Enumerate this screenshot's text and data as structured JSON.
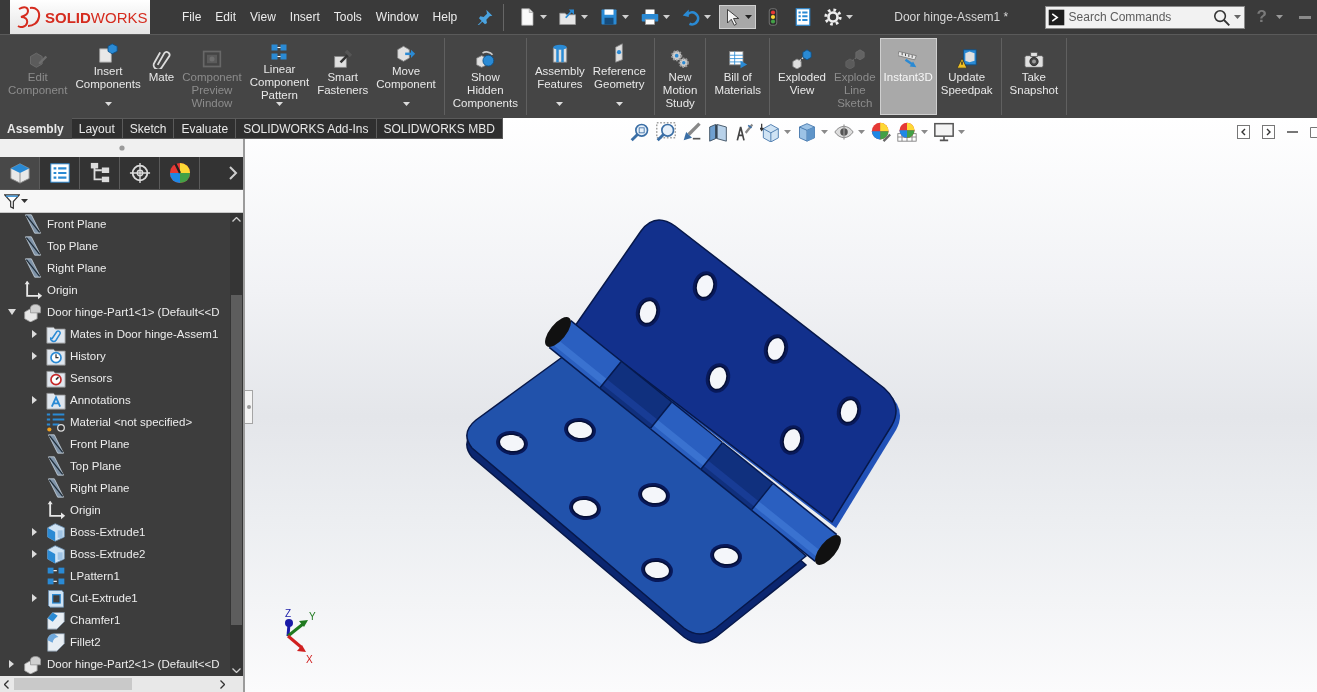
{
  "title_bar": {
    "logo": "**SOLID**WORKS",
    "menu": [
      "File",
      "Edit",
      "View",
      "Insert",
      "Tools",
      "Window",
      "Help"
    ],
    "quick_access": [
      {
        "kind": "document",
        "dropdown": true,
        "selected": false
      },
      {
        "kind": "folder",
        "dropdown": true,
        "selected": false
      },
      {
        "kind": "disk",
        "dropdown": true,
        "selected": false
      },
      {
        "kind": "printer",
        "dropdown": true,
        "selected": false
      },
      {
        "kind": "undo",
        "dropdown": true,
        "selected": false
      },
      {
        "kind": "pointer",
        "dropdown": true,
        "selected": true
      },
      {
        "kind": "trafficlight",
        "dropdown": false,
        "selected": false
      },
      {
        "kind": "list",
        "dropdown": false,
        "selected": false
      },
      {
        "kind": "gear",
        "dropdown": true,
        "selected": false
      }
    ],
    "document_title": "Door hinge-Assem1 *",
    "search": {
      "placeholder": "Search Commands"
    },
    "help": "?"
  },
  "ribbon": {
    "groups": [
      {
        "items": [
          {
            "label": "Edit Component",
            "kind": "editcomponent",
            "disabled": true,
            "selected": false,
            "dropdown": false
          },
          {
            "label": "Insert Components",
            "kind": "insert",
            "disabled": false,
            "selected": false,
            "dropdown": true
          },
          {
            "label": "Mate",
            "kind": "mate",
            "disabled": false,
            "selected": false,
            "dropdown": false
          },
          {
            "label": "Component Preview Window",
            "kind": "preview",
            "disabled": true,
            "selected": false,
            "dropdown": false
          },
          {
            "label": "Linear Component Pattern",
            "kind": "pattern",
            "disabled": false,
            "selected": false,
            "dropdown": true
          },
          {
            "label": "Smart Fasteners",
            "kind": "fasteners",
            "disabled": false,
            "selected": false,
            "dropdown": false
          },
          {
            "label": "Move Component",
            "kind": "move",
            "disabled": false,
            "selected": false,
            "dropdown": true
          }
        ]
      },
      {
        "items": [
          {
            "label": "Show Hidden Components",
            "kind": "show",
            "disabled": false,
            "selected": false,
            "dropdown": false
          }
        ]
      },
      {
        "items": [
          {
            "label": "Assembly Features",
            "kind": "features",
            "disabled": false,
            "selected": false,
            "dropdown": true
          },
          {
            "label": "Reference Geometry",
            "kind": "reference",
            "disabled": false,
            "selected": false,
            "dropdown": true
          }
        ]
      },
      {
        "items": [
          {
            "label": "New Motion Study",
            "kind": "motion",
            "disabled": false,
            "selected": false,
            "dropdown": false
          }
        ]
      },
      {
        "items": [
          {
            "label": "Bill of Materials",
            "kind": "bom",
            "disabled": false,
            "selected": false,
            "dropdown": false
          }
        ]
      },
      {
        "items": [
          {
            "label": "Exploded View",
            "kind": "explode",
            "disabled": false,
            "selected": false,
            "dropdown": false
          },
          {
            "label": "Explode Line Sketch",
            "kind": "explodeline",
            "disabled": true,
            "selected": false,
            "dropdown": false
          },
          {
            "label": "Instant3D",
            "kind": "instant3d",
            "disabled": false,
            "selected": true,
            "dropdown": false
          },
          {
            "label": "Update Speedpak",
            "kind": "speedpak",
            "disabled": false,
            "selected": false,
            "dropdown": false
          }
        ]
      },
      {
        "items": [
          {
            "label": "Take Snapshot",
            "kind": "snapshot",
            "disabled": false,
            "selected": false,
            "dropdown": false
          }
        ]
      }
    ]
  },
  "command_tabs": [
    {
      "label": "Assembly",
      "selected": true
    },
    {
      "label": "Layout",
      "selected": false
    },
    {
      "label": "Sketch",
      "selected": false
    },
    {
      "label": "Evaluate",
      "selected": false
    },
    {
      "label": "SOLIDWORKS Add-Ins",
      "selected": false
    },
    {
      "label": "SOLIDWORKS MBD",
      "selected": false
    }
  ],
  "panel": {
    "tabs": [
      {
        "kind": "features",
        "selected": true
      },
      {
        "kind": "properties",
        "selected": false
      },
      {
        "kind": "configurations",
        "selected": false
      },
      {
        "kind": "dimxpert",
        "selected": false
      },
      {
        "kind": "display",
        "selected": false
      }
    ],
    "tree": [
      {
        "label": "Front Plane",
        "kind": "plane"
      },
      {
        "label": "Top Plane",
        "kind": "plane"
      },
      {
        "label": "Right Plane",
        "kind": "plane"
      },
      {
        "label": "Origin",
        "kind": "origin"
      },
      {
        "label": "Door hinge-Part1<1> (Default<<D",
        "kind": "part",
        "expanded": true,
        "children": [
          {
            "label": "Mates in Door hinge-Assem1",
            "kind": "mates",
            "expanded": false
          },
          {
            "label": "History",
            "kind": "history",
            "expanded": false
          },
          {
            "label": "Sensors",
            "kind": "sensors"
          },
          {
            "label": "Annotations",
            "kind": "annotations",
            "expanded": false
          },
          {
            "label": "Material <not specified>",
            "kind": "material"
          },
          {
            "label": "Front Plane",
            "kind": "plane"
          },
          {
            "label": "Top Plane",
            "kind": "plane"
          },
          {
            "label": "Right Plane",
            "kind": "plane"
          },
          {
            "label": "Origin",
            "kind": "origin"
          },
          {
            "label": "Boss-Extrude1",
            "kind": "extrude",
            "expanded": false
          },
          {
            "label": "Boss-Extrude2",
            "kind": "extrude",
            "expanded": false
          },
          {
            "label": "LPattern1",
            "kind": "lpattern"
          },
          {
            "label": "Cut-Extrude1",
            "kind": "cut",
            "expanded": false
          },
          {
            "label": "Chamfer1",
            "kind": "chamfer"
          },
          {
            "label": "Fillet2",
            "kind": "fillet"
          }
        ]
      },
      {
        "label": "Door hinge-Part2<1> (Default<<D",
        "kind": "part",
        "expanded": false
      }
    ]
  },
  "viewport": {
    "view_toolbar": [
      {
        "kind": "zoomfit",
        "dropdown": false
      },
      {
        "kind": "zoomarea",
        "dropdown": false
      },
      {
        "kind": "previous",
        "dropdown": false
      },
      {
        "kind": "section",
        "dropdown": false
      },
      {
        "kind": "annotation",
        "dropdown": false
      },
      {
        "kind": "orientation",
        "dropdown": true
      },
      {
        "kind": "displaystyle",
        "dropdown": true
      },
      {
        "kind": "hideshow",
        "dropdown": true
      },
      {
        "kind": "appearance",
        "dropdown": false
      },
      {
        "kind": "scene",
        "dropdown": true
      },
      {
        "kind": "viewsettings",
        "dropdown": true
      }
    ],
    "triad": {
      "x": "X",
      "y": "Y",
      "z": "Z"
    }
  }
}
